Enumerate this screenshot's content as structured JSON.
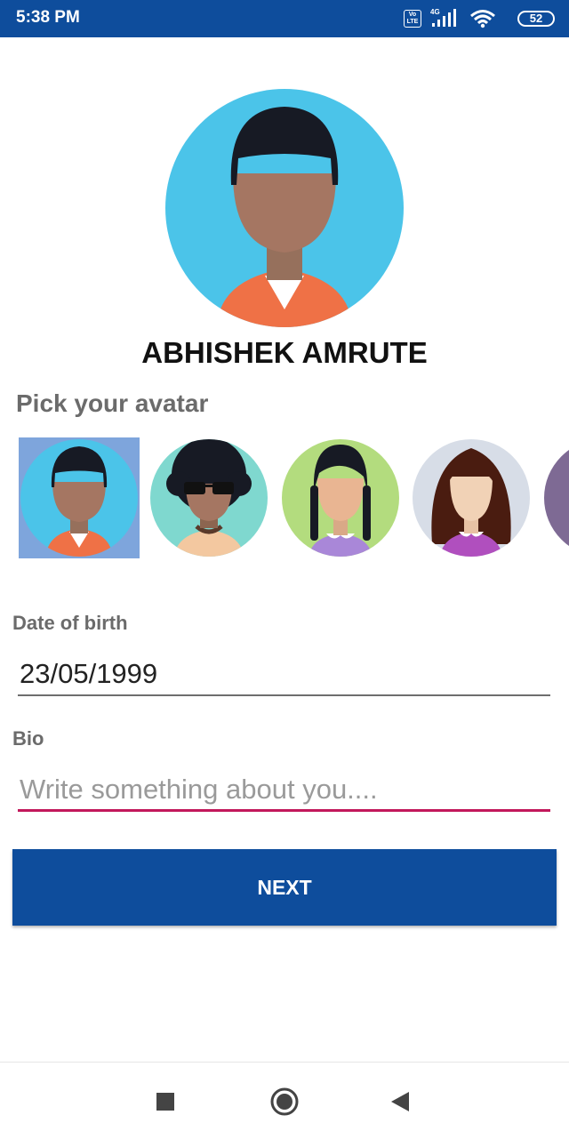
{
  "status_bar": {
    "time": "5:38 PM",
    "volte": "Vo LTE",
    "network": "4G",
    "battery": "52",
    "background": "#0e4d9c"
  },
  "profile": {
    "name": "ABHISHEK AMRUTE",
    "avatar_icon": "avatar-boy-icon"
  },
  "avatar_picker": {
    "label": "Pick your avatar",
    "options": [
      {
        "icon": "avatar-boy-icon",
        "selected": true
      },
      {
        "icon": "avatar-curly-sunglasses-icon",
        "selected": false
      },
      {
        "icon": "avatar-girl-braids-icon",
        "selected": false
      },
      {
        "icon": "avatar-woman-long-hair-icon",
        "selected": false
      },
      {
        "icon": "avatar-partial-icon",
        "selected": false
      }
    ]
  },
  "form": {
    "dob_label": "Date of birth",
    "dob_value": "23/05/1999",
    "bio_label": "Bio",
    "bio_placeholder": "Write something about you....",
    "bio_value": "",
    "accent_color": "#c2185b"
  },
  "next_button": {
    "label": "NEXT",
    "color": "#0e4d9c"
  },
  "nav_bar": {
    "items": [
      "square-recents-icon",
      "circle-home-icon",
      "triangle-back-icon"
    ]
  }
}
